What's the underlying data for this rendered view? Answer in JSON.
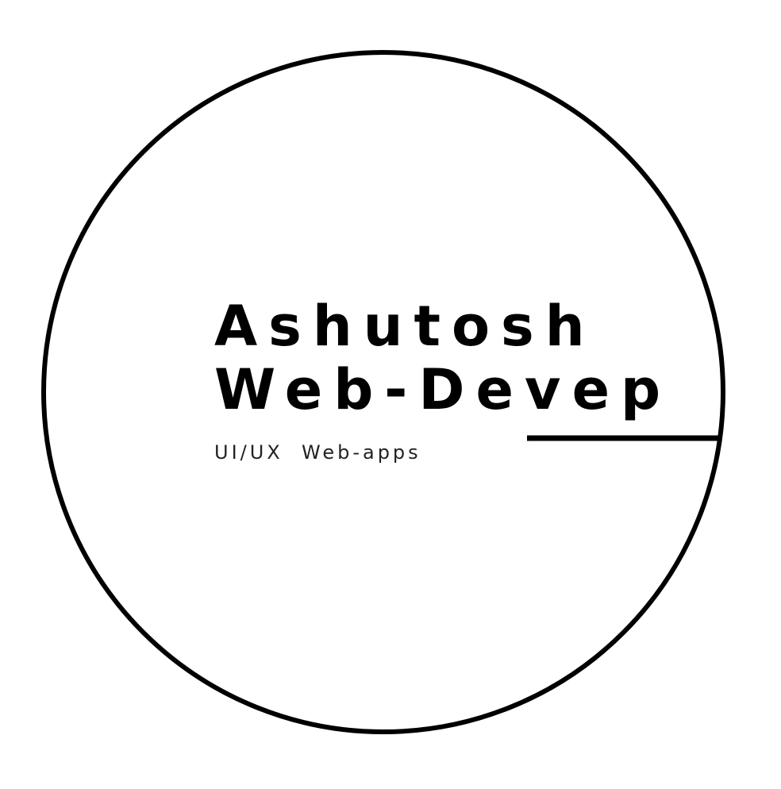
{
  "logo": {
    "title_line_1": "Ashutosh",
    "title_line_2": "Web-Devep",
    "tagline": "UI/UX  Web-apps",
    "colors": {
      "background": "#ffffff",
      "ink": "#000000",
      "tagline": "#222222"
    }
  }
}
